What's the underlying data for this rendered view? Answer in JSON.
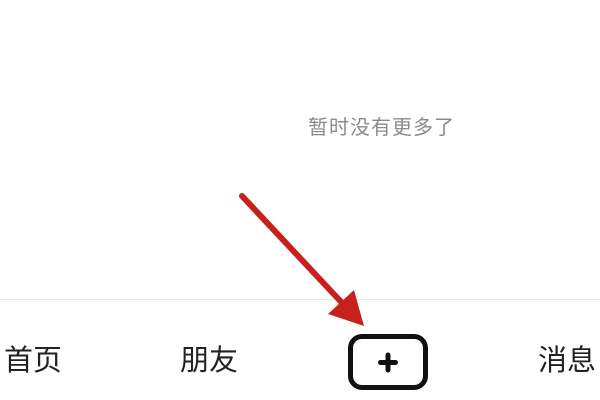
{
  "feed": {
    "end_message": "暂时没有更多了"
  },
  "tabbar": {
    "tabs": [
      {
        "label": "首页"
      },
      {
        "label": "朋友"
      },
      {
        "label": "消息"
      }
    ],
    "create_icon": "plus-icon"
  },
  "annotation": {
    "arrow_icon": "red-arrow-icon",
    "arrow_color": "#c8201c"
  }
}
